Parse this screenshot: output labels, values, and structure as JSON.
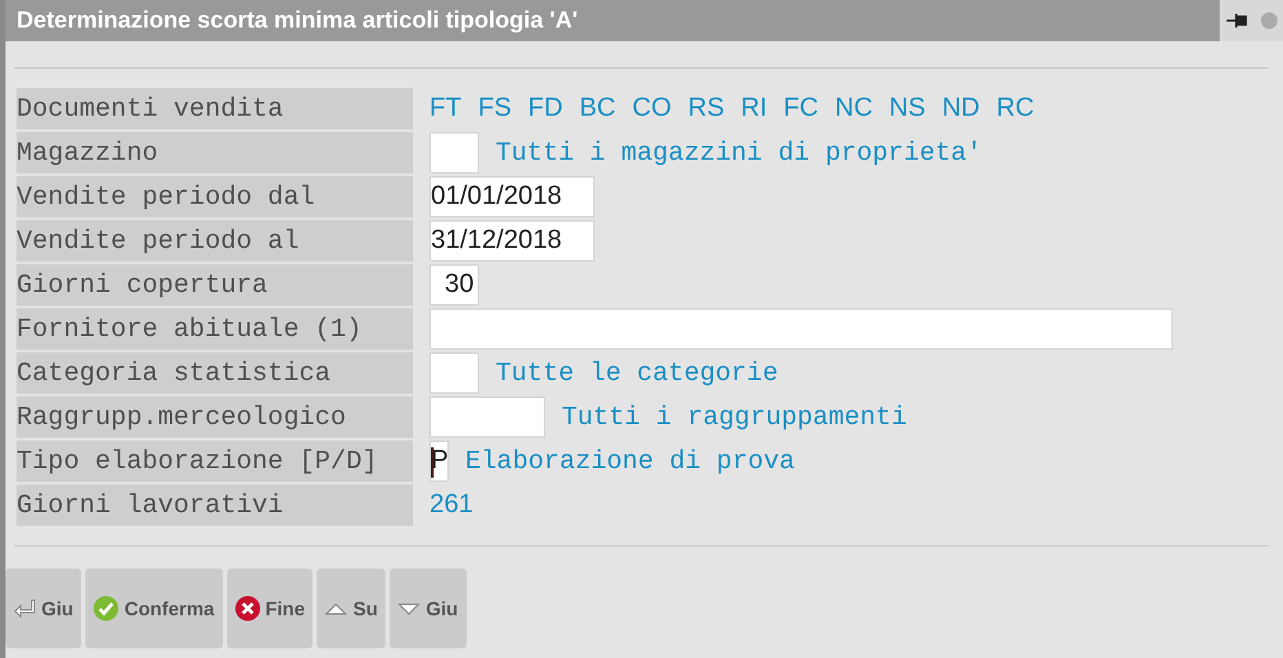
{
  "window": {
    "title": "Determinazione scorta minima articoli tipologia 'A'"
  },
  "rows": [
    {
      "label": "Documenti vendita",
      "kind": "codes",
      "codes": [
        "FT",
        "FS",
        "FD",
        "BC",
        "CO",
        "RS",
        "RI",
        "FC",
        "NC",
        "NS",
        "ND",
        "RC"
      ]
    },
    {
      "label": "Magazzino",
      "kind": "short_field",
      "value": "",
      "note": "Tutti i magazzini di proprieta'"
    },
    {
      "label": "Vendite periodo dal",
      "kind": "date_field",
      "value": "01/01/2018"
    },
    {
      "label": "Vendite periodo al",
      "kind": "date_field",
      "value": "31/12/2018"
    },
    {
      "label": "Giorni copertura",
      "kind": "short_field",
      "value": "30"
    },
    {
      "label": "Fornitore abituale (1)",
      "kind": "long_field",
      "value": ""
    },
    {
      "label": "Categoria statistica",
      "kind": "short_field",
      "value": "",
      "note": "Tutte le categorie"
    },
    {
      "label": "Raggrupp.merceologico",
      "kind": "medium_field",
      "value": "",
      "note": "Tutti i raggruppamenti"
    },
    {
      "label": "Tipo elaborazione [P/D]",
      "kind": "char_field",
      "value": "P",
      "focused": true,
      "note": "Elaborazione di prova"
    },
    {
      "label": "Giorni lavorativi",
      "kind": "value",
      "value": "261"
    }
  ],
  "buttons": [
    {
      "label": "Giu",
      "kind": "enter"
    },
    {
      "label": "Conferma",
      "kind": "confirm"
    },
    {
      "label": "Fine",
      "kind": "cancel"
    },
    {
      "label": "Su",
      "kind": "up"
    },
    {
      "label": "Giu",
      "kind": "down"
    }
  ]
}
